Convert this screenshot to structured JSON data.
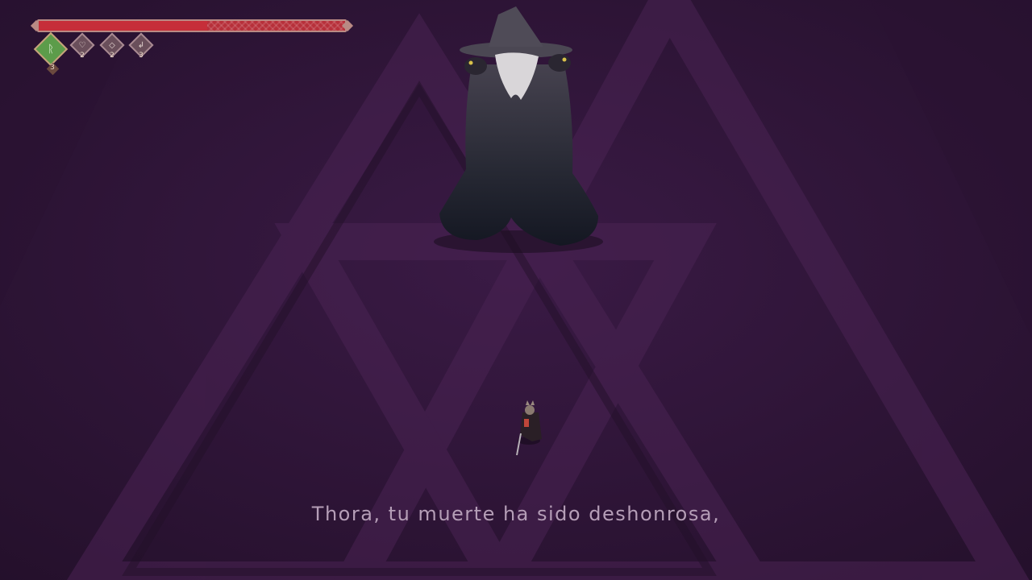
{
  "hud": {
    "health": {
      "fraction": 0.55,
      "color": "#c62e39"
    },
    "abilities": [
      {
        "name": "primary-rune",
        "icon": "rune-icon",
        "count": "3",
        "active": true
      },
      {
        "name": "ability-2",
        "icon": "heart-icon",
        "count": "2",
        "active": false
      },
      {
        "name": "ability-3",
        "icon": "shield-icon",
        "count": "2",
        "active": false
      },
      {
        "name": "ability-4",
        "icon": "arrow-icon",
        "count": "3",
        "active": false
      }
    ]
  },
  "subtitle": {
    "text": "Thora, tu muerte ha sido deshonrosa,"
  },
  "colors": {
    "background": "#2e1536",
    "floor_pattern": "#3c1d45",
    "subtitle": "#b59eb7"
  }
}
